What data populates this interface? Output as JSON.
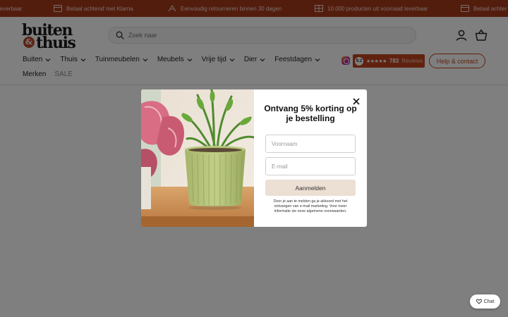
{
  "announcement": {
    "items": [
      {
        "text": "Betaal achteraf met Klarna",
        "icon": "credit-card-icon"
      },
      {
        "text": "Eenvoudig retourneren binnen 30 dagen",
        "icon": "return-box-icon"
      },
      {
        "text": "10.000 producten uit voorraad leverbaar",
        "icon": "warehouse-icon"
      }
    ],
    "partial_left": "leverbaar",
    "partial_right": "Betaal achter"
  },
  "header": {
    "logo_line1": "buiten",
    "logo_amp": "&",
    "logo_line2": "thuis",
    "search_placeholder": "Zoek naar",
    "nav": [
      "Buiten",
      "Thuis",
      "Tuinmeubelen",
      "Meubels",
      "Vrije tijd",
      "Dier",
      "Feestdagen"
    ],
    "nav2": {
      "brands": "Merken",
      "sale": "SALE"
    },
    "reviews": {
      "score": "9.2",
      "stars": "★★★★★",
      "count": "783",
      "label": "Reviews"
    },
    "help_label": "Help & contact"
  },
  "popup": {
    "title": "Ontvang 5% korting op je bestelling",
    "firstname_placeholder": "Voornaam",
    "email_placeholder": "E-mail",
    "submit_label": "Aanmelden",
    "disclaimer": "Door je aan te melden ga je akkoord met het ontvangen van e-mail marketing. Voor meer informatie zie onze algemene voorwaarden."
  },
  "chat": {
    "label": "Chat"
  },
  "colors": {
    "brand": "#a63b1c",
    "accent": "#c0451f",
    "button_bg": "#ecdfd3"
  }
}
